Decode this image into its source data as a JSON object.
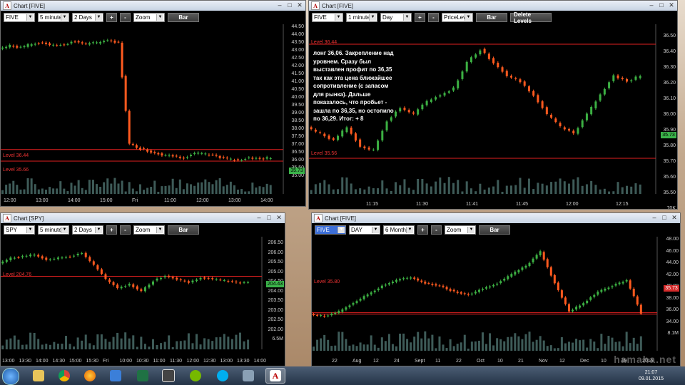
{
  "chart_data": [
    {
      "type": "candlestick",
      "title": "Chart [FIVE]",
      "series": [
        {
          "name": "FIVE",
          "values": [
            43.2,
            43.4,
            43.3,
            43.5,
            43.6,
            43.4,
            43.5,
            43.7,
            43.5,
            43.6,
            43.8,
            43.6,
            36.8,
            36.5,
            36.3,
            36.1,
            36.0,
            35.9,
            36.2,
            36.1,
            36.0,
            35.8,
            35.7,
            35.9,
            35.8,
            35.9
          ]
        }
      ],
      "ylim": [
        34.8,
        44.6
      ],
      "levels": [
        36.44,
        35.66
      ],
      "last_price": 35.73
    },
    {
      "type": "candlestick",
      "title": "Chart [FIVE]",
      "series": [
        {
          "name": "FIVE",
          "values": [
            35.8,
            35.75,
            35.7,
            35.8,
            35.65,
            35.62,
            35.85,
            35.95,
            35.9,
            36.0,
            36.05,
            36.1,
            36.3,
            36.4,
            36.3,
            36.2,
            36.15,
            36.05,
            35.9,
            35.8,
            35.75,
            35.9,
            36.05,
            36.2,
            36.15,
            36.2
          ]
        }
      ],
      "ylim": [
        35.45,
        36.55
      ],
      "levels": [
        36.44,
        35.56
      ],
      "last_price": 35.73
    },
    {
      "type": "candlestick",
      "title": "Chart [SPY]",
      "series": [
        {
          "name": "SPY",
          "values": [
            205.5,
            205.8,
            205.9,
            206.0,
            205.7,
            205.8,
            205.9,
            206.1,
            205.4,
            204.6,
            204.1,
            204.3,
            203.9,
            204.5,
            204.8,
            204.6,
            204.4,
            204.7,
            204.6,
            204.5,
            204.4,
            204.4
          ]
        }
      ],
      "ylim": [
        201.8,
        206.7
      ],
      "levels": [
        204.76
      ],
      "last_price": 204.43
    },
    {
      "type": "candlestick",
      "title": "Chart [FIVE]",
      "series": [
        {
          "name": "FIVE",
          "values": [
            35.5,
            35.2,
            36.0,
            37.5,
            39.0,
            40.5,
            41.5,
            42.0,
            41.0,
            40.5,
            39.5,
            39.0,
            40.0,
            41.0,
            42.5,
            44.0,
            46.5,
            41.0,
            36.0,
            37.5,
            39.5,
            40.5,
            41.5,
            35.73
          ]
        }
      ],
      "ylim": [
        33.5,
        48.5
      ],
      "levels": [
        35.8,
        35.56
      ],
      "last_price": 35.73
    }
  ],
  "windows": {
    "tl": {
      "title": "Chart [FIVE]",
      "symbol": "FIVE",
      "interval": "5 minutes",
      "range": "2 Days",
      "zoom": "Zoom",
      "type_btn": "Bar",
      "plus": "+",
      "minus": "-",
      "yticks": [
        "44.50",
        "44.00",
        "43.50",
        "43.00",
        "42.50",
        "42.00",
        "41.50",
        "41.00",
        "40.50",
        "40.00",
        "39.50",
        "39.00",
        "38.50",
        "38.00",
        "37.50",
        "37.00",
        "36.50",
        "36.00",
        "35.50",
        "35.00"
      ],
      "xticks": [
        "12:00",
        "13:00",
        "14:00",
        "15:00",
        "Fri",
        "11:00",
        "12:00",
        "13:00",
        "14:00"
      ],
      "levels": [
        "Level 36.44",
        "Level 35.66"
      ],
      "price": "35.73"
    },
    "tr": {
      "title": "Chart [FIVE]",
      "symbol": "FIVE",
      "interval": "1 minute",
      "range": "Day",
      "tool": "PriceLeve",
      "type_btn": "Bar",
      "delete_btn": "Delete Levels",
      "plus": "+",
      "minus": "-",
      "yticks": [
        "36.50",
        "36.40",
        "36.30",
        "36.20",
        "36.10",
        "36.00",
        "35.90",
        "35.80",
        "35.70",
        "35.60",
        "35.50",
        "70K"
      ],
      "xticks": [
        "11:15",
        "11:30",
        "11:41",
        "11:45",
        "12:00",
        "12:15"
      ],
      "levels": [
        "Level 36.44",
        "Level 35.56"
      ],
      "price": "35.73",
      "note": "лонг 36,06. Закрепление над\nуровнем. Сразу был\nвыставлен профит по 36,35\nтак как эта цена ближайшее\nсопротивление (с запасом\nдля рынка). Дальше\nпоказалось, что пробьет -\nзашла по 36,35, но остопило\nпо 36,29. Итог: + 8"
    },
    "bl": {
      "title": "Chart [SPY]",
      "symbol": "SPY",
      "interval": "5 minutes",
      "range": "2 Days",
      "zoom": "Zoom",
      "type_btn": "Bar",
      "plus": "+",
      "minus": "-",
      "yticks": [
        "206.50",
        "206.00",
        "205.50",
        "205.00",
        "204.50",
        "204.00",
        "203.50",
        "203.00",
        "202.50",
        "202.00",
        "6.5M"
      ],
      "xticks": [
        "13:00",
        "13:30",
        "14:00",
        "14:30",
        "15:00",
        "15:30",
        "Fri",
        "10:00",
        "10:30",
        "11:00",
        "11:30",
        "12:00",
        "12:30",
        "13:00",
        "13:30",
        "14:00"
      ],
      "levels": [
        "Level 204.76"
      ],
      "price": "204.43"
    },
    "br": {
      "title": "Chart [FIVE]",
      "symbol": "FIVE",
      "interval": "DAY",
      "range": "6 Months",
      "zoom": "Zoom",
      "type_btn": "Bar",
      "plus": "+",
      "minus": "-",
      "yticks": [
        "48.00",
        "46.00",
        "44.00",
        "42.00",
        "40.00",
        "38.00",
        "36.00",
        "34.00",
        "8.1M"
      ],
      "xticks": [
        "22",
        "Aug",
        "12",
        "24",
        "Sept",
        "11",
        "22",
        "Oct",
        "10",
        "21",
        "Nov",
        "12",
        "Dec",
        "10",
        "19",
        "2015"
      ],
      "levels": [
        "Level 35.80"
      ],
      "price": "35.73",
      "watermark": "hamaha.net"
    }
  },
  "taskbar": {
    "apps": [
      "start-orb",
      "folder-icon",
      "chrome-icon",
      "firefox-icon",
      "store-icon",
      "excel-icon",
      "media-icon",
      "utorrent-icon",
      "skype-icon",
      "tool-icon",
      "chart-app-icon"
    ],
    "time": "21:07",
    "date": "09.01.2015"
  },
  "colors": {
    "up": "#3cb043",
    "down": "#ff5a1f",
    "level": "#e02020",
    "bg": "#000000",
    "volume": "#3e5b58"
  }
}
